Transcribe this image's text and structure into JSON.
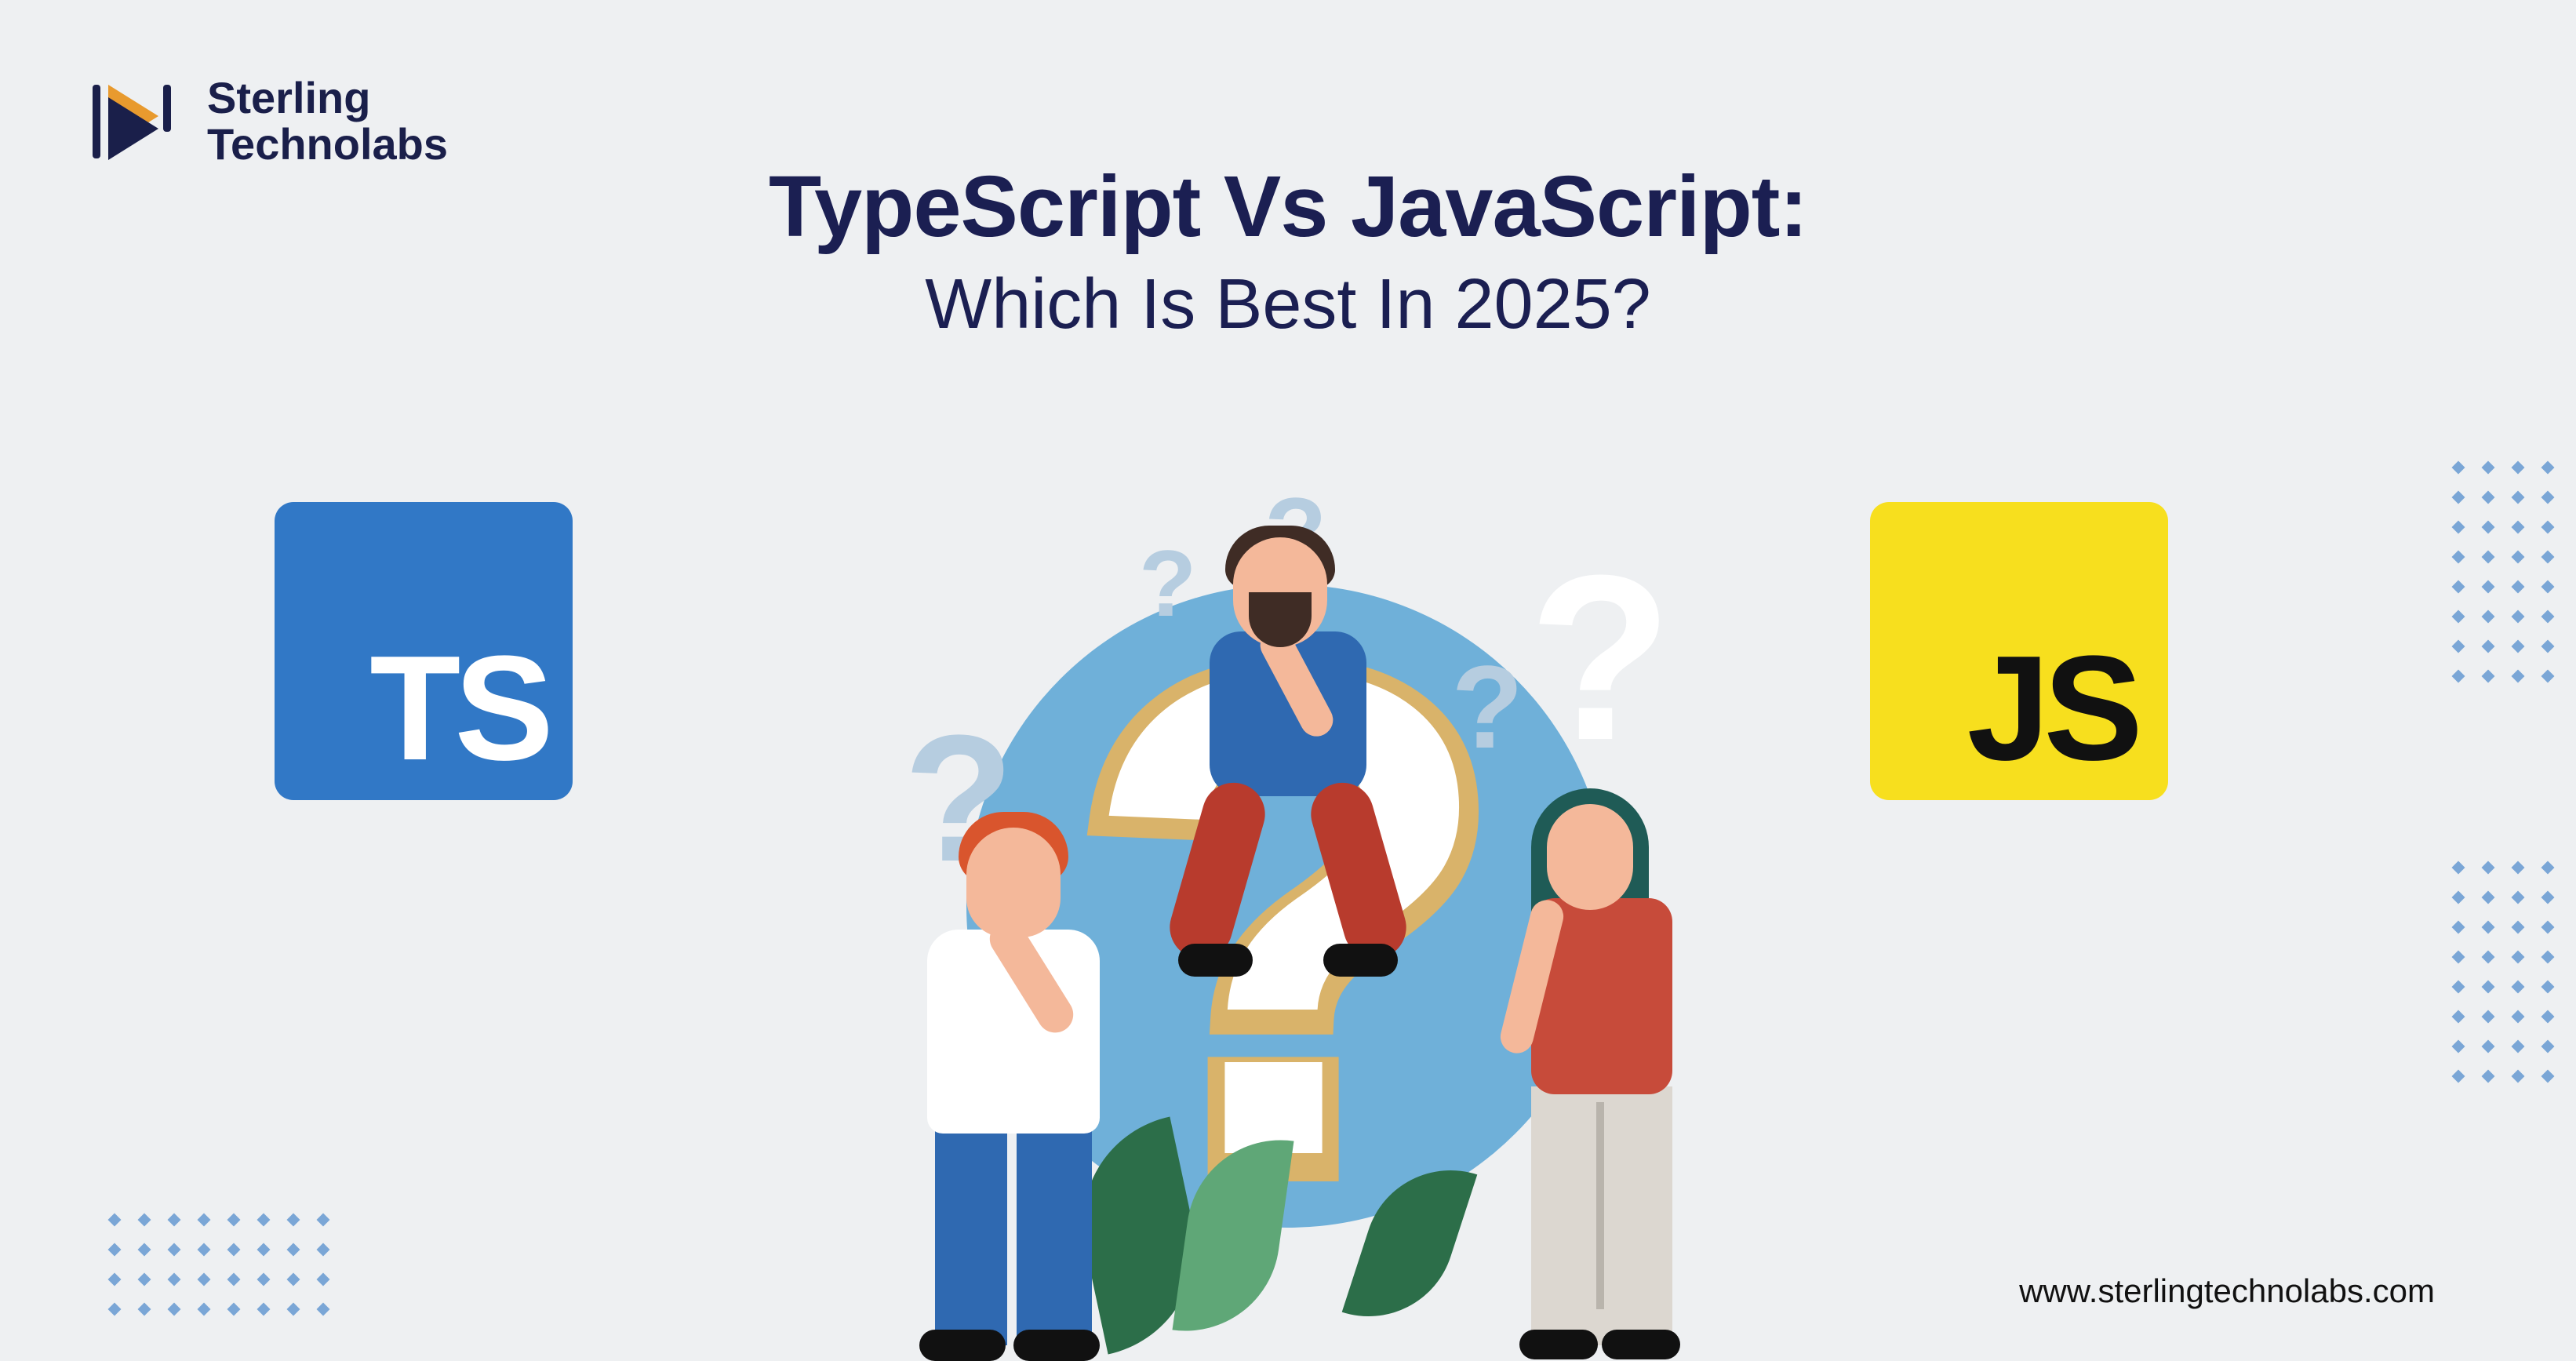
{
  "brand": {
    "name_line1": "Sterling",
    "name_line2": "Technolabs"
  },
  "hero": {
    "title_line1": "TypeScript Vs JavaScript:",
    "title_line2": "Which Is Best In 2025?"
  },
  "badges": {
    "ts_label": "TS",
    "js_label": "JS",
    "ts_color": "#3178c6",
    "js_color": "#f7df1e"
  },
  "illustration": {
    "main_symbol": "?",
    "floating_symbols": [
      "?",
      "?",
      "?",
      "?",
      "?",
      "?"
    ]
  },
  "footer": {
    "url": "www.sterlingtechnolabs.com"
  }
}
